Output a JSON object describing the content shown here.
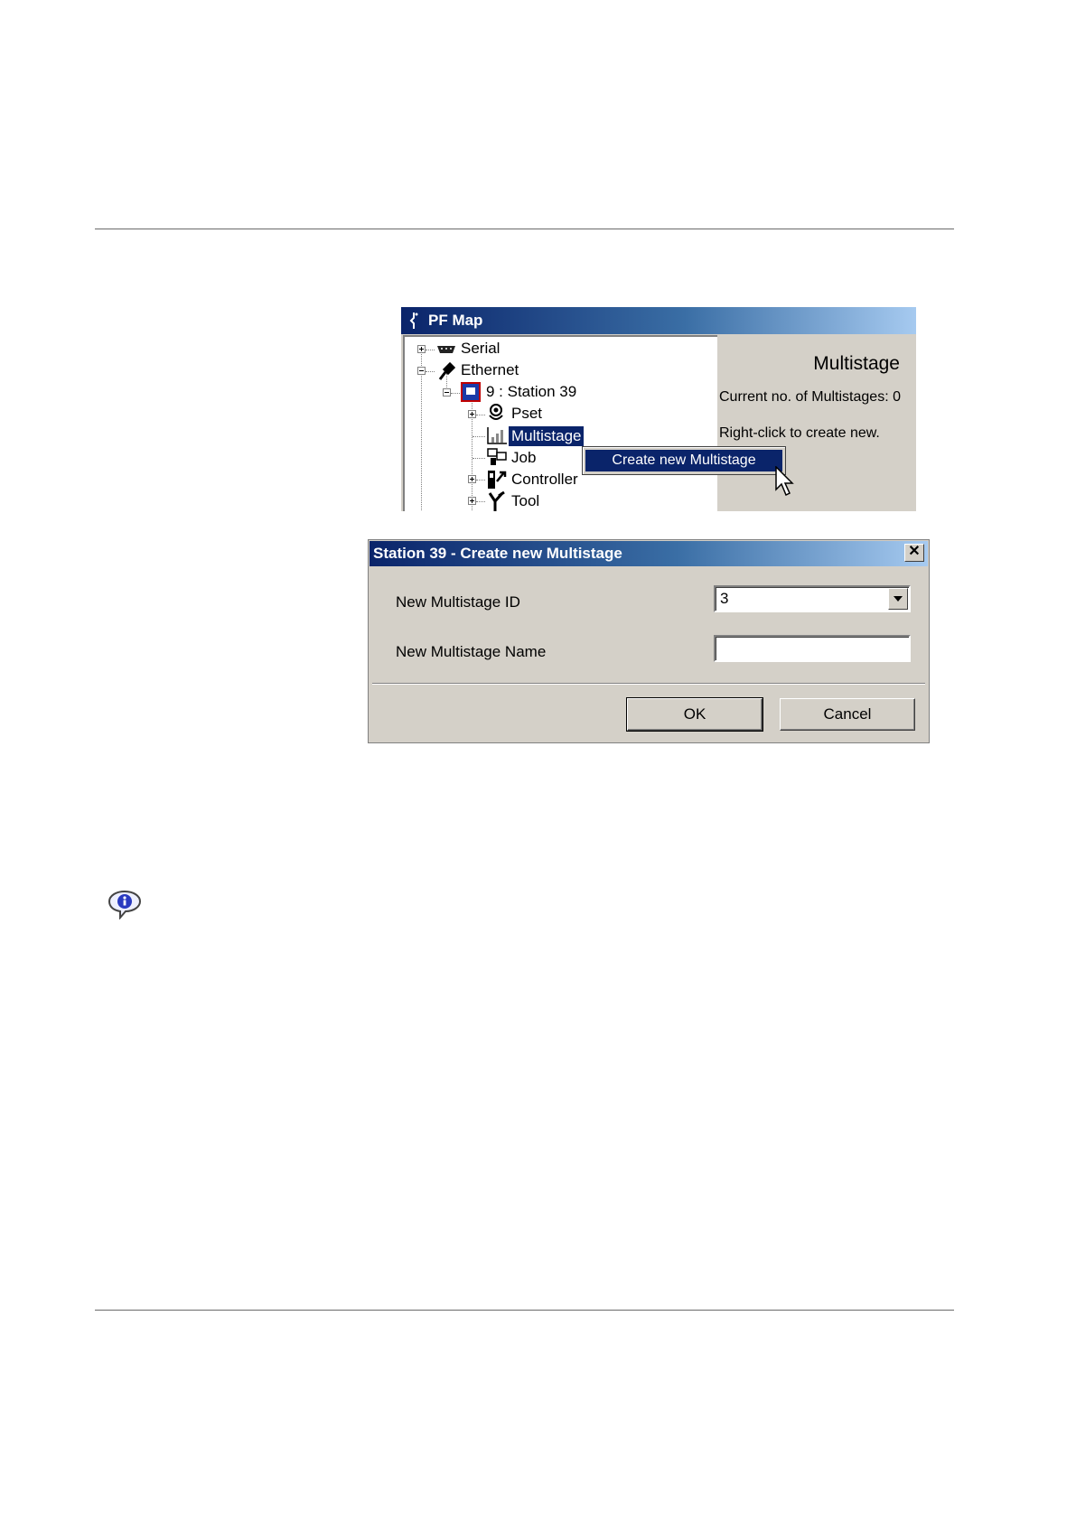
{
  "pf_map": {
    "title": "PF Map",
    "tree": [
      {
        "label": "Serial",
        "icon": "serial-connector-icon",
        "expander": "plus"
      },
      {
        "label": "Ethernet",
        "icon": "ethernet-plug-icon",
        "expander": "minus"
      },
      {
        "label": "9 : Station 39",
        "icon": "station-icon",
        "expander": "minus"
      },
      {
        "label": "Pset",
        "icon": "pset-icon",
        "expander": "plus"
      },
      {
        "label": "Multistage",
        "icon": "multistage-icon",
        "expander": "none",
        "selected": true
      },
      {
        "label": "Job",
        "icon": "job-icon",
        "expander": "none"
      },
      {
        "label": "Controller",
        "icon": "controller-icon",
        "expander": "plus"
      },
      {
        "label": "Tool",
        "icon": "tool-icon",
        "expander": "plus"
      }
    ],
    "info": {
      "heading": "Multistage",
      "count_text": "Current no. of Multistages: 0",
      "hint": "Right-click to create new."
    },
    "context_menu": {
      "item": "Create new Multistage"
    }
  },
  "dialog": {
    "title": "Station 39 - Create new Multistage",
    "close_glyph": "✕",
    "id_label": "New Multistage ID",
    "id_value": "3",
    "name_label": "New Multistage Name",
    "name_value": "",
    "ok_label": "OK",
    "cancel_label": "Cancel"
  },
  "colors": {
    "titlebar_start": "#0a246a",
    "titlebar_end": "#a6caf0",
    "window_bg": "#d4d0c8",
    "selection": "#0a246a"
  }
}
